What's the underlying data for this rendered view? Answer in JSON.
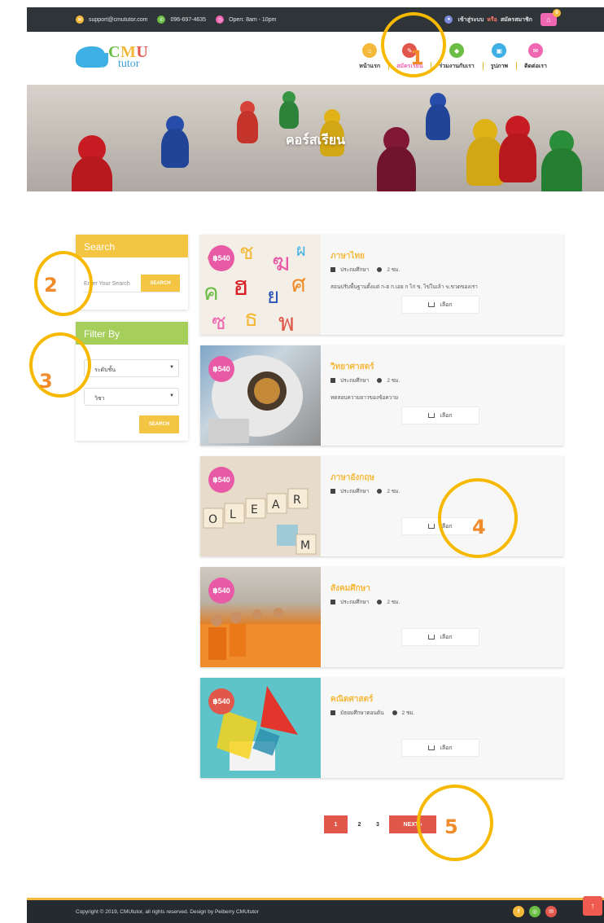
{
  "topbar": {
    "email": "support@cmututor.com",
    "phone": "096-697-4635",
    "hours": "Open: 8am - 10pm",
    "login": "เข้าสู่ระบบ",
    "or": "หรือ",
    "register": "สมัครสมาชิก",
    "cart_count": "0"
  },
  "logo": {
    "c": "C",
    "m": "M",
    "u": "U",
    "sub": "tutor"
  },
  "menu": [
    {
      "label": "หน้าแรก",
      "icon": "home-icon",
      "color": "#f4b93a"
    },
    {
      "label": "สมัครเรียน",
      "icon": "pencil-icon",
      "color": "#e2574c"
    },
    {
      "label": "ร่วมงานกับเรา",
      "icon": "handshake-icon",
      "color": "#6bbd45"
    },
    {
      "label": "รูปภาพ",
      "icon": "image-icon",
      "color": "#3fb0e6"
    },
    {
      "label": "ติดต่อเรา",
      "icon": "mail-icon",
      "color": "#ef67b0"
    }
  ],
  "hero": {
    "title": "คอร์สเรียน"
  },
  "search": {
    "heading": "Search",
    "placeholder": "Enter Your Search",
    "button": "SEARCH"
  },
  "filter": {
    "heading": "Filter By",
    "level_value": "ระดับชั้น",
    "subject_value": "วิชา",
    "button": "SEARCH"
  },
  "courses": [
    {
      "price": "฿540",
      "title": "ภาษาไทย",
      "level": "ประถมศึกษา",
      "hours": "2 ชม.",
      "desc": "สอนปรับพื้นฐานตั้งแต่ ก-ฮ ก.เอย ก ไก่ ข. ไข่ในเล้า ฃ.ขวดของเรา",
      "button": "เลือก"
    },
    {
      "price": "฿540",
      "title": "วิทยาศาสตร์",
      "level": "ประถมศึกษา",
      "hours": "2 ชม.",
      "desc": "ทดสอบความยาวของข้อความ",
      "button": "เลือก"
    },
    {
      "price": "฿540",
      "title": "ภาษาอังกฤษ",
      "level": "ประถมศึกษา",
      "hours": "2 ชม.",
      "desc": "",
      "button": "เลือก"
    },
    {
      "price": "฿540",
      "title": "สังคมศึกษา",
      "level": "ประถมศึกษา",
      "hours": "2 ชม.",
      "desc": "",
      "button": "เลือก"
    },
    {
      "price": "฿540",
      "title": "คณิตศาสตร์",
      "level": "มัธยมศึกษาตอนต้น",
      "hours": "2 ชม.",
      "desc": "",
      "button": "เลือก"
    }
  ],
  "pagination": {
    "p1": "1",
    "p2": "2",
    "p3": "3",
    "next": "NEXT ›"
  },
  "footer": {
    "copyright": "Copyright © 2019, CMUtutor, all rights reserved. Design by Peiberry CMUtutor",
    "social": [
      "f",
      "◎",
      "✉"
    ],
    "to_top": "↑"
  },
  "annotations": [
    "1",
    "2",
    "3",
    "4",
    "5"
  ],
  "colors": {
    "yellow": "#f4c542",
    "green": "#a5cf5a",
    "pink": "#e85aa6",
    "red": "#e2574c",
    "dark": "#2e3438"
  }
}
